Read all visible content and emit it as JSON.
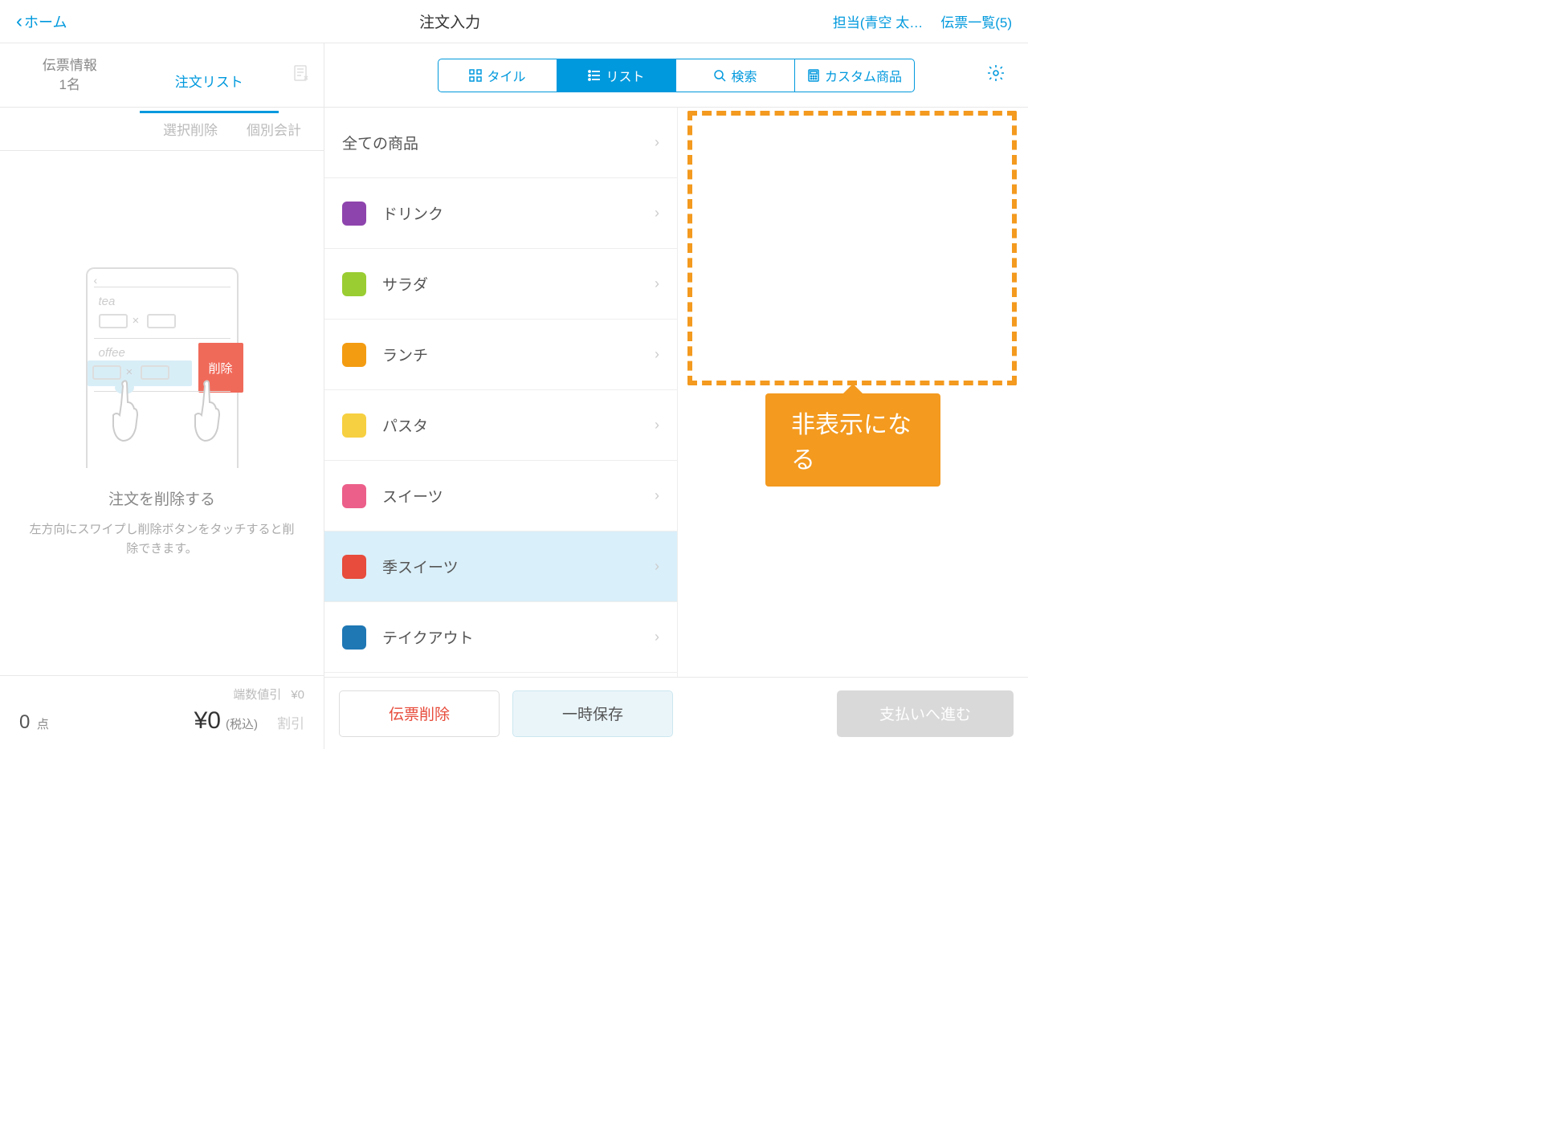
{
  "header": {
    "back_label": "ホーム",
    "title": "注文入力",
    "staff_label": "担当(青空 太…",
    "receipts_label": "伝票一覧(5)"
  },
  "sidebar": {
    "tab_info_line1": "伝票情報",
    "tab_info_line2": "1名",
    "tab_list": "注文リスト",
    "action_delete": "選択削除",
    "action_split": "個別会計",
    "hint_title": "注文を削除する",
    "hint_desc": "左方向にスワイプし削除ボタンをタッチすると削除できます。",
    "illus_delete": "削除",
    "footer": {
      "rounding_label": "端数値引",
      "rounding_value": "¥0",
      "qty": "0",
      "qty_unit": "点",
      "total": "¥0",
      "tax_label": "(税込)",
      "discount_label": "割引"
    }
  },
  "segments": {
    "tile": "タイル",
    "list": "リスト",
    "search": "検索",
    "custom": "カスタム商品"
  },
  "categories": [
    {
      "label": "全て の商品",
      "color": "",
      "all": true
    },
    {
      "label": "ドリンク",
      "color": "#8e44ad"
    },
    {
      "label": "サラダ",
      "color": "#9acd32"
    },
    {
      "label": "ランチ",
      "color": "#f39c12"
    },
    {
      "label": "パスタ",
      "color": "#f7d041"
    },
    {
      "label": "スイーツ",
      "color": "#ec5f8a"
    },
    {
      "label": "季スイーツ",
      "color": "#e74c3c",
      "selected": true
    },
    {
      "label": "テイクアウト",
      "color": "#1f77b4"
    }
  ],
  "callout": "非表示になる",
  "footer": {
    "delete": "伝票削除",
    "save": "一時保存",
    "pay": "支払いへ進む"
  }
}
